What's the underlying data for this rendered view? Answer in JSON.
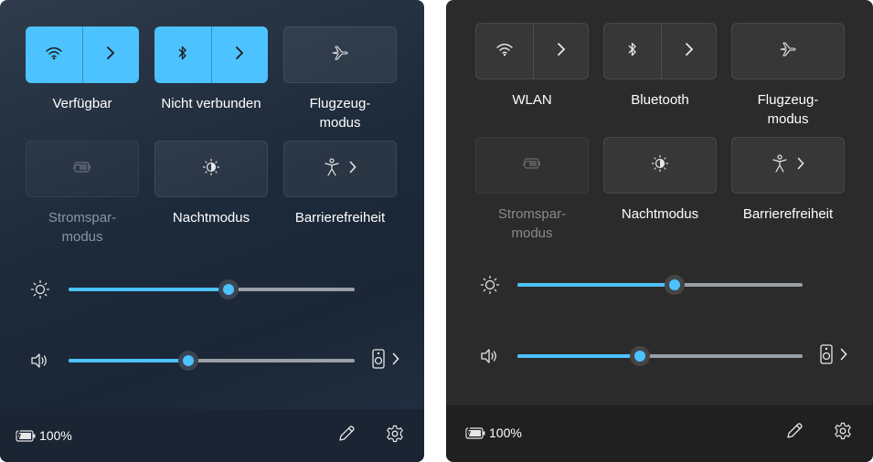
{
  "panel_transparent": {
    "tiles": {
      "wifi": {
        "label": "Verfügbar",
        "state": "on",
        "icon": "wifi-icon"
      },
      "bluetooth": {
        "label": "Nicht verbunden",
        "state": "on",
        "icon": "bluetooth-icon"
      },
      "airplane": {
        "label_line1": "Flugzeug-",
        "label_line2": "modus",
        "state": "off",
        "icon": "airplane-icon"
      },
      "battery_saver": {
        "label_line1": "Stromspar-",
        "label_line2": "modus",
        "state": "disabled",
        "icon": "battery-saver-icon"
      },
      "night_light": {
        "label": "Nachtmodus",
        "state": "off",
        "icon": "night-light-icon"
      },
      "accessibility": {
        "label": "Barrierefreiheit",
        "state": "off",
        "icon": "accessibility-icon"
      }
    },
    "brightness_level": 0.56,
    "volume_level": 0.42,
    "battery": {
      "percent": "100%"
    }
  },
  "panel_solid": {
    "tiles": {
      "wifi": {
        "label": "WLAN",
        "state": "off",
        "icon": "wifi-icon"
      },
      "bluetooth": {
        "label": "Bluetooth",
        "state": "off",
        "icon": "bluetooth-icon"
      },
      "airplane": {
        "label_line1": "Flugzeug-",
        "label_line2": "modus",
        "state": "off",
        "icon": "airplane-icon"
      },
      "battery_saver": {
        "label_line1": "Stromspar-",
        "label_line2": "modus",
        "state": "disabled",
        "icon": "battery-saver-icon"
      },
      "night_light": {
        "label": "Nachtmodus",
        "state": "off",
        "icon": "night-light-icon"
      },
      "accessibility": {
        "label": "Barrierefreiheit",
        "state": "off",
        "icon": "accessibility-icon"
      }
    },
    "brightness_level": 0.55,
    "volume_level": 0.43,
    "battery": {
      "percent": "100%"
    }
  },
  "colors": {
    "accent": "#4cc2ff",
    "panel_solid_bg": "#2b2b2b",
    "panel_transparent_bg": "#1d2a3a"
  }
}
